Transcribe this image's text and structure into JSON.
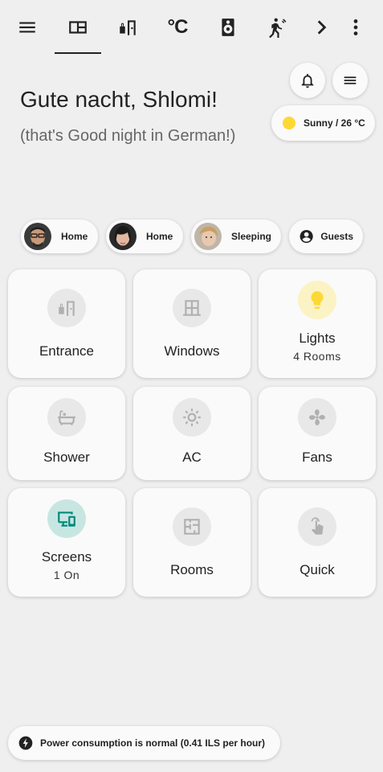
{
  "greeting": {
    "title": "Gute nacht, Shlomi!",
    "subtitle": "(that's Good night in German!)"
  },
  "weather": {
    "label": "Sunny / 26 °C"
  },
  "topbar": {
    "celsius_label": "°C"
  },
  "people": [
    {
      "label": "Home"
    },
    {
      "label": "Home"
    },
    {
      "label": "Sleeping"
    },
    {
      "label": "Guests"
    }
  ],
  "tiles": [
    {
      "name": "Entrance",
      "sub": ""
    },
    {
      "name": "Windows",
      "sub": ""
    },
    {
      "name": "Lights",
      "sub": "4 Rooms"
    },
    {
      "name": "Shower",
      "sub": ""
    },
    {
      "name": "AC",
      "sub": ""
    },
    {
      "name": "Fans",
      "sub": ""
    },
    {
      "name": "Screens",
      "sub": "1 On"
    },
    {
      "name": "Rooms",
      "sub": ""
    },
    {
      "name": "Quick",
      "sub": ""
    }
  ],
  "footer": {
    "status": "Power consumption is normal (0.41 ILS per hour)"
  },
  "colors": {
    "background": "#efefef",
    "card": "#fafafa",
    "lights_active": "#fdd835",
    "screens_active": "#00897b"
  }
}
